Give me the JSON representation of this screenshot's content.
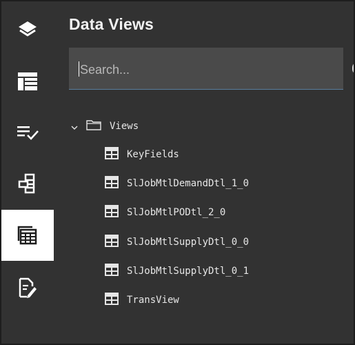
{
  "panel": {
    "title": "Data Views"
  },
  "search": {
    "placeholder": "Search..."
  },
  "tree": {
    "root_label": "Views",
    "items": [
      {
        "label": "KeyFields"
      },
      {
        "label": "SlJobMtlDemandDtl_1_0"
      },
      {
        "label": "SlJobMtlPODtl_2_0"
      },
      {
        "label": "SlJobMtlSupplyDtl_0_0"
      },
      {
        "label": "SlJobMtlSupplyDtl_0_1"
      },
      {
        "label": "TransView"
      }
    ]
  },
  "rail": {
    "items": [
      {
        "icon": "layers-icon"
      },
      {
        "icon": "layout-icon"
      },
      {
        "icon": "checklist-icon"
      },
      {
        "icon": "hierarchy-icon"
      },
      {
        "icon": "data-views-icon",
        "active": true
      },
      {
        "icon": "document-edit-icon"
      }
    ]
  },
  "colors": {
    "background": "#323232",
    "active_tab": "#ffffff",
    "search_bg": "#4a4a4a",
    "search_underline": "#5a7f9e",
    "text": "#e6e6e6"
  }
}
